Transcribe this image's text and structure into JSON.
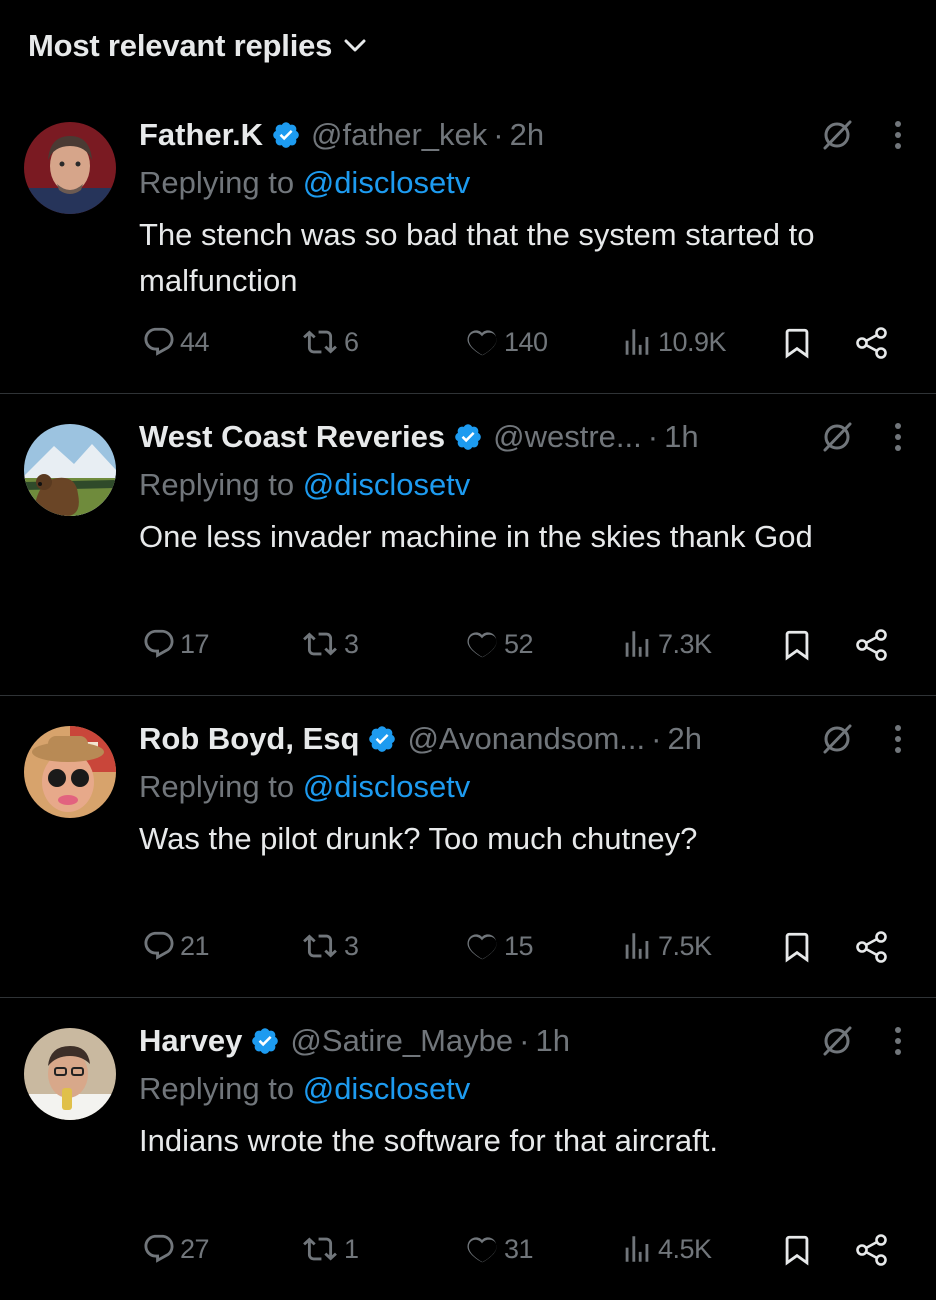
{
  "header": {
    "title": "Most relevant replies",
    "chevron_icon": "chevron-down-icon"
  },
  "colors": {
    "background": "#000000",
    "text": "#e7e9ea",
    "muted": "#71767b",
    "accent": "#1d9bf0",
    "divider": "#2f3336"
  },
  "replies": [
    {
      "name": "Father.K",
      "handle": "@father_kek",
      "time": "2h",
      "replying_prefix": "Replying to ",
      "replying_to": "@disclosetv",
      "text": "The stench was so bad that the system started to malfunction",
      "replies": "44",
      "reposts": "6",
      "likes": "140",
      "views": "10.9K"
    },
    {
      "name": "West Coast Reveries",
      "handle": "@westre...",
      "time": "1h",
      "replying_prefix": "Replying to ",
      "replying_to": "@disclosetv",
      "text": "One less invader machine in the skies thank God",
      "replies": "17",
      "reposts": "3",
      "likes": "52",
      "views": "7.3K"
    },
    {
      "name": "Rob Boyd, Esq",
      "handle": "@Avonandsom...",
      "time": "2h",
      "replying_prefix": "Replying to ",
      "replying_to": "@disclosetv",
      "text": "Was the pilot drunk? Too much chutney?",
      "replies": "21",
      "reposts": "3",
      "likes": "15",
      "views": "7.5K"
    },
    {
      "name": "Harvey",
      "handle": "@Satire_Maybe",
      "time": "1h",
      "replying_prefix": "Replying to ",
      "replying_to": "@disclosetv",
      "text": "Indians wrote the software for that aircraft.",
      "replies": "27",
      "reposts": "1",
      "likes": "31",
      "views": "4.5K"
    }
  ],
  "separator": "·"
}
